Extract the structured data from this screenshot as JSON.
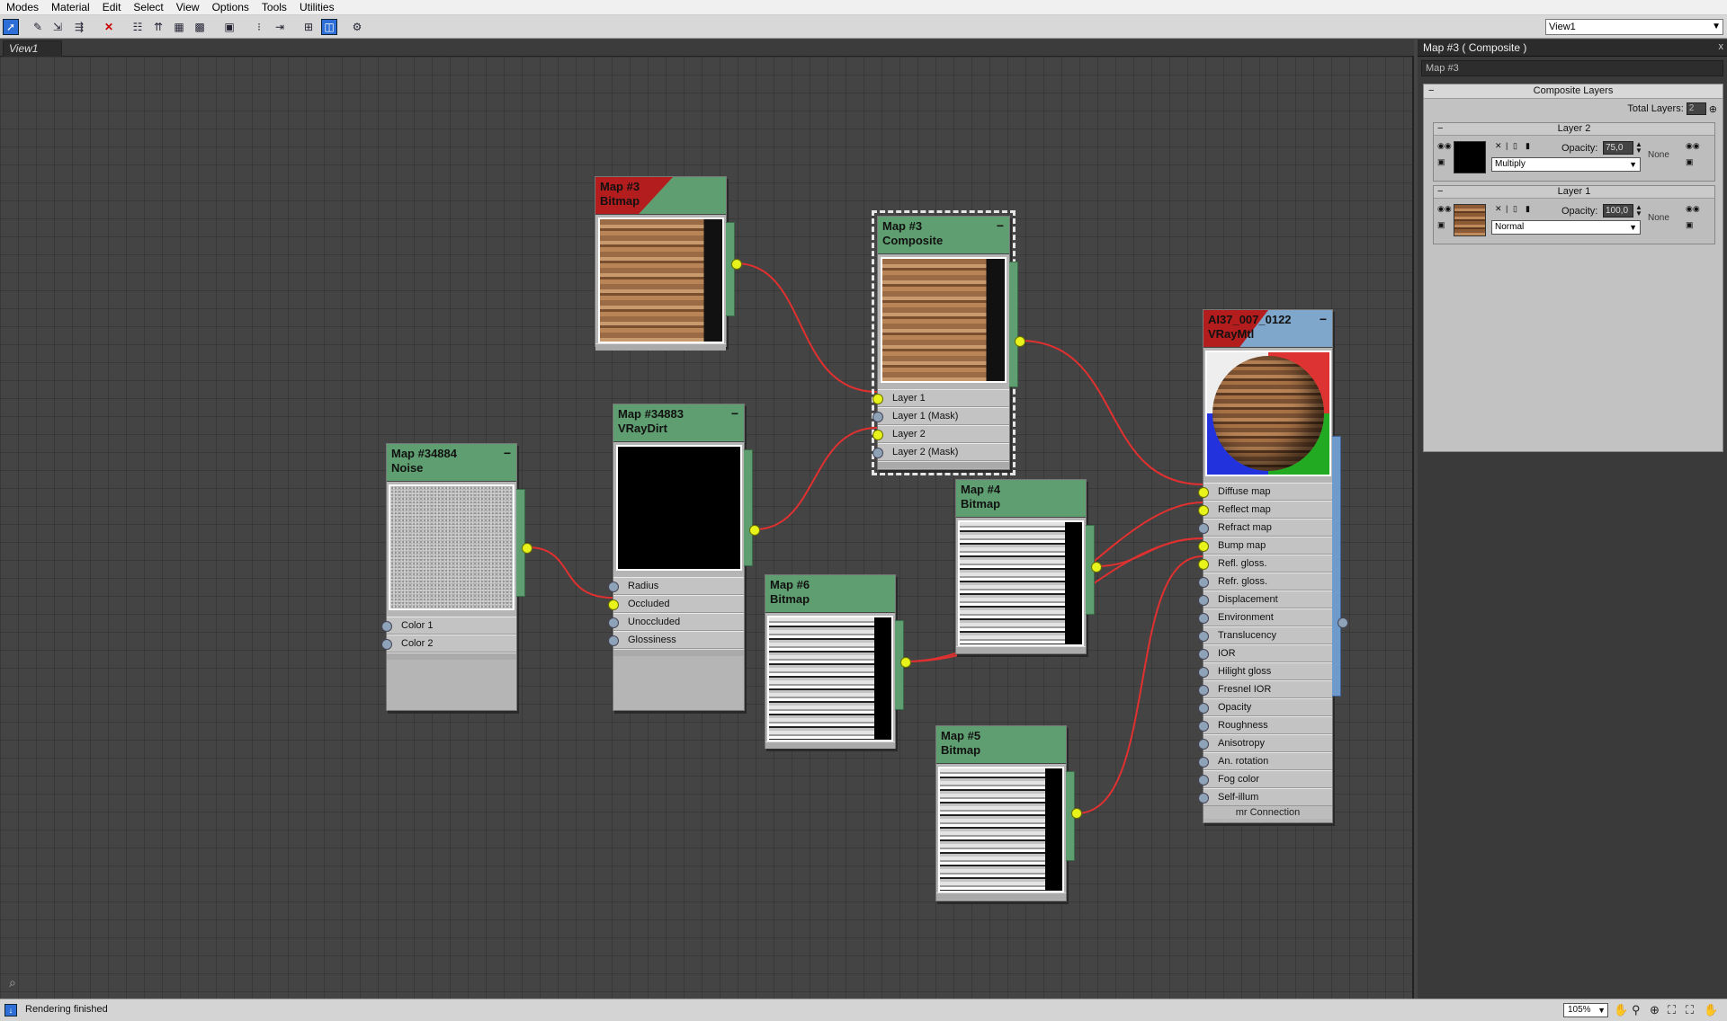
{
  "menu": [
    "Modes",
    "Material",
    "Edit",
    "Select",
    "View",
    "Options",
    "Tools",
    "Utilities"
  ],
  "toolbar_icons": [
    "select-icon",
    "pick-icon",
    "move-children-icon",
    "assign-icon",
    "delete-icon",
    "layout-icon",
    "layout-children-icon",
    "show-map-icon",
    "checker-icon",
    "background-icon",
    "zoom-icon",
    "extent-icon",
    "navigator-icon",
    "params-icon",
    "options-icon"
  ],
  "view_selector": "View1",
  "view_tab": "View1",
  "nodes": {
    "bitmap3": {
      "line1": "Map #3",
      "line2": "Bitmap"
    },
    "composite": {
      "line1": "Map #3",
      "line2": "Composite",
      "slots": [
        "Layer 1",
        "Layer 1 (Mask)",
        "Layer 2",
        "Layer 2 (Mask)"
      ]
    },
    "noise": {
      "line1": "Map #34884",
      "line2": "Noise",
      "slots": [
        "Color 1",
        "Color 2"
      ]
    },
    "vraydirt": {
      "line1": "Map #34883",
      "line2": "VRayDirt",
      "slots": [
        "Radius",
        "Occluded",
        "Unoccluded",
        "Glossiness"
      ]
    },
    "bitmap4": {
      "line1": "Map #4",
      "line2": "Bitmap"
    },
    "bitmap6": {
      "line1": "Map #6",
      "line2": "Bitmap"
    },
    "bitmap5": {
      "line1": "Map #5",
      "line2": "Bitmap"
    },
    "material": {
      "line1": "AI37_007_0122",
      "line2": "VRayMtl",
      "slots": [
        "Diffuse map",
        "Reflect map",
        "Refract map",
        "Bump map",
        "Refl. gloss.",
        "Refr. gloss.",
        "Displacement",
        "Environment",
        "Translucency",
        "IOR",
        "Hilight gloss",
        "Fresnel IOR",
        "Opacity",
        "Roughness",
        "Anisotropy",
        "An. rotation",
        "Fog color",
        "Self-illum"
      ],
      "footer": "mr Connection"
    }
  },
  "panel": {
    "title": "Map #3  ( Composite )",
    "close": "x",
    "name": "Map #3",
    "rollout_title": "Composite Layers",
    "total_label": "Total Layers:",
    "total_value": "2",
    "layers": [
      {
        "title": "Layer 2",
        "opacity_label": "Opacity:",
        "opacity": "75,0",
        "blend": "Multiply",
        "none": "None"
      },
      {
        "title": "Layer 1",
        "opacity_label": "Opacity:",
        "opacity": "100,0",
        "blend": "Normal",
        "none": "None"
      }
    ]
  },
  "status": {
    "text": "Rendering finished",
    "zoom": "105%"
  }
}
